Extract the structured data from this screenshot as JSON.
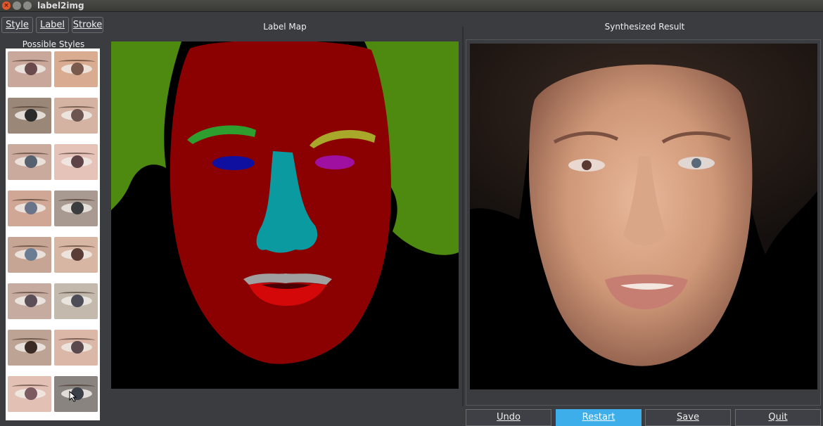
{
  "window": {
    "title": "label2img"
  },
  "toolbar": {
    "style_label": "Style",
    "label_label": "Label",
    "stroke_label": "Stroke"
  },
  "styles_panel": {
    "title": "Possible Styles",
    "thumbnails": [
      {
        "iris": "#6b4a4e",
        "skin": "#c9a79a"
      },
      {
        "iris": "#7a5a4c",
        "skin": "#d9ab90"
      },
      {
        "iris": "#2b2b2b",
        "skin": "#9a8778"
      },
      {
        "iris": "#6d5652",
        "skin": "#d5b3a3"
      },
      {
        "iris": "#55616e",
        "skin": "#c9aa9c"
      },
      {
        "iris": "#5d4348",
        "skin": "#e5c3b8"
      },
      {
        "iris": "#6a7488",
        "skin": "#d0a795"
      },
      {
        "iris": "#3b3c3e",
        "skin": "#a89a90"
      },
      {
        "iris": "#6a7d92",
        "skin": "#c7a594"
      },
      {
        "iris": "#5a3d36",
        "skin": "#d7b6a3"
      },
      {
        "iris": "#5c4e57",
        "skin": "#c6aca0"
      },
      {
        "iris": "#4d4d55",
        "skin": "#c3baad"
      },
      {
        "iris": "#3a2c25",
        "skin": "#bda393"
      },
      {
        "iris": "#5a4a4e",
        "skin": "#dbb7a8"
      },
      {
        "iris": "#7c5a62",
        "skin": "#e3c0b4"
      },
      {
        "iris": "#3a3f48",
        "skin": "#8a8480"
      }
    ]
  },
  "label_map": {
    "title": "Label Map"
  },
  "synth": {
    "title": "Synthesized Result"
  },
  "actions": {
    "undo_label": "Undo",
    "restart_label": "Restart",
    "save_label": "Save",
    "quit_label": "Quit"
  },
  "colors": {
    "background": "#00aa00",
    "face": "#8b0000",
    "brow_left": "#2e9e2e",
    "brow_right": "#a8a82a",
    "eye_left": "#1010a0",
    "eye_right": "#a010a0",
    "nose": "#0a9aa0",
    "upper_lip": "#a0a0a0",
    "lower_lip": "#d40808",
    "accent": "#3daee9"
  }
}
